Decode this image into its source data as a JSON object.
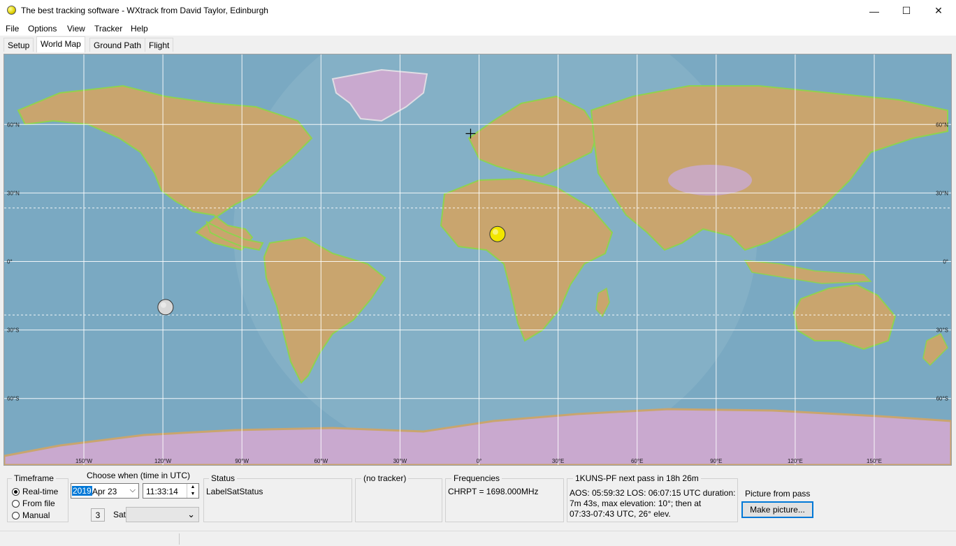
{
  "window": {
    "title": "The best tracking software - WXtrack from David Taylor, Edinburgh",
    "controls": {
      "minimize": "—",
      "maximize": "☐",
      "close": "✕"
    }
  },
  "menu": [
    "File",
    "Options",
    "View",
    "Tracker",
    "Help"
  ],
  "tabs": [
    {
      "label": "Setup",
      "active": false
    },
    {
      "label": "World Map",
      "active": true
    },
    {
      "label": "Ground Path",
      "active": false
    },
    {
      "label": "Flight",
      "active": false
    }
  ],
  "map": {
    "lat_labels": [
      "60°N",
      "30°N",
      "0°",
      "30°S",
      "60°S"
    ],
    "lon_labels": [
      "150°W",
      "120°W",
      "90°W",
      "60°W",
      "30°W",
      "0°",
      "30°E",
      "60°E",
      "90°E",
      "120°E",
      "150°E"
    ],
    "colors": {
      "ocean": "#7aa9c2",
      "land": "#c9a56e",
      "green": "#8fd24f",
      "ice": "#c9a9cf",
      "grid": "#ffffff"
    },
    "markers": [
      {
        "name": "sun",
        "lon": 7,
        "lat": 12,
        "color": "#f2e600"
      },
      {
        "name": "moon",
        "lon": -119,
        "lat": -20,
        "color": "#d8d8d8"
      }
    ],
    "observer": {
      "lon": -3.2,
      "lat": 56
    }
  },
  "timeframe": {
    "title": "Timeframe",
    "options": [
      {
        "label": "Real-time",
        "selected": true
      },
      {
        "label": "From file",
        "selected": false
      },
      {
        "label": "Manual",
        "selected": false
      }
    ]
  },
  "choose_when": {
    "title": "Choose when (time in UTC)",
    "year": "2019",
    "date": "Apr 23",
    "time": "11:33:14",
    "count": "3",
    "sat_label": "Sat",
    "sat_value": ""
  },
  "status": {
    "title": "Status",
    "text": "LabelSatStatus"
  },
  "tracker": {
    "title": "(no tracker)"
  },
  "frequencies": {
    "title": "Frequencies",
    "text": "CHRPT = 1698.000MHz"
  },
  "next_pass": {
    "title": "1KUNS-PF next pass in 18h 26m",
    "line1": "AOS: 05:59:32  LOS: 06:07:15 UTC  duration:",
    "line2": "7m 43s,  max elevation: 10°;  then at",
    "line3": "07:33-07:43 UTC, 26° elev."
  },
  "picture": {
    "label": "Picture from pass",
    "button": "Make picture..."
  }
}
